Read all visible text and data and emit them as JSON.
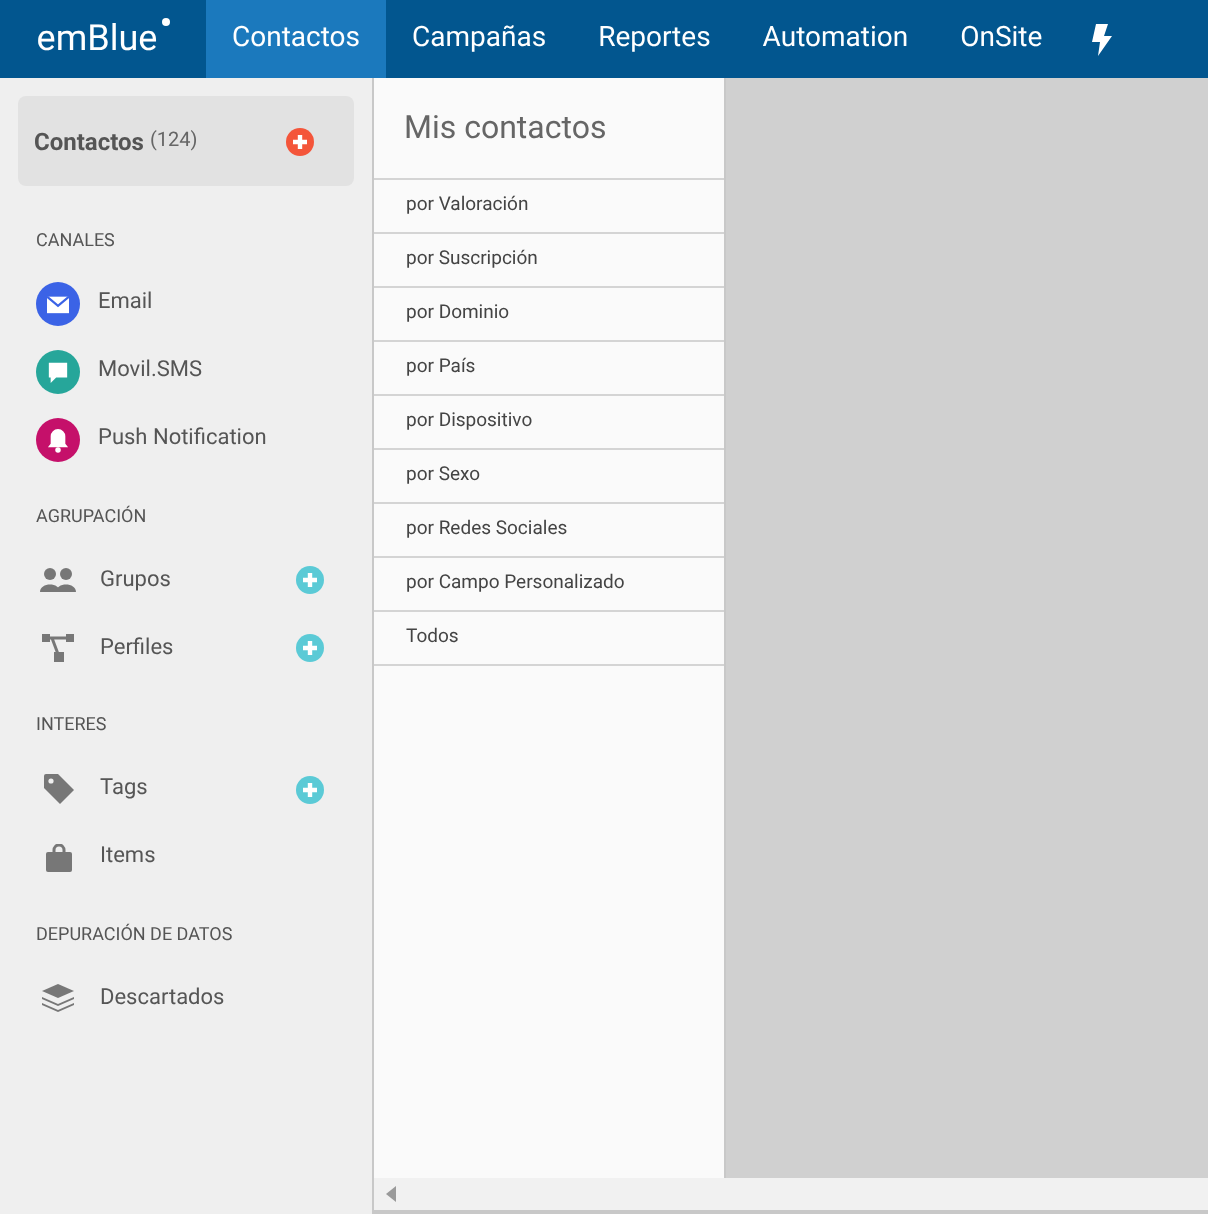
{
  "brand": {
    "logo": "emBlue"
  },
  "nav": [
    {
      "label": "Contactos",
      "selected": true
    },
    {
      "label": "Campañas",
      "selected": false
    },
    {
      "label": "Reportes",
      "selected": false
    },
    {
      "label": "Automation",
      "selected": false
    },
    {
      "label": "OnSite",
      "selected": false
    }
  ],
  "contacts_card": {
    "title": "Contactos",
    "count": "(124)"
  },
  "sections": [
    {
      "heading": "CANALES",
      "items": [
        {
          "label": "Email",
          "color": "#3b63e6",
          "can_add": false
        },
        {
          "label": "Movil.SMS",
          "color": "#26a69a",
          "can_add": false
        },
        {
          "label": "Push Notification",
          "color": "#c5106a",
          "can_add": false
        }
      ]
    },
    {
      "heading": "AGRUPACIÓN",
      "items": [
        {
          "label": "Grupos",
          "can_add": true
        },
        {
          "label": "Perfiles",
          "can_add": true
        }
      ]
    },
    {
      "heading": "INTERES",
      "items": [
        {
          "label": "Tags",
          "can_add": true
        },
        {
          "label": "Items",
          "can_add": false
        }
      ]
    },
    {
      "heading": "DEPURACIÓN DE DATOS",
      "items": [
        {
          "label": "Descartados",
          "can_add": false
        }
      ]
    }
  ],
  "panel": {
    "title": "Mis contactos",
    "items": [
      "por Valoración",
      "por Suscripción",
      "por Dominio",
      "por País",
      "por Dispositivo",
      "por Sexo",
      "por Redes Sociales",
      "por Campo Personalizado",
      "Todos"
    ]
  }
}
